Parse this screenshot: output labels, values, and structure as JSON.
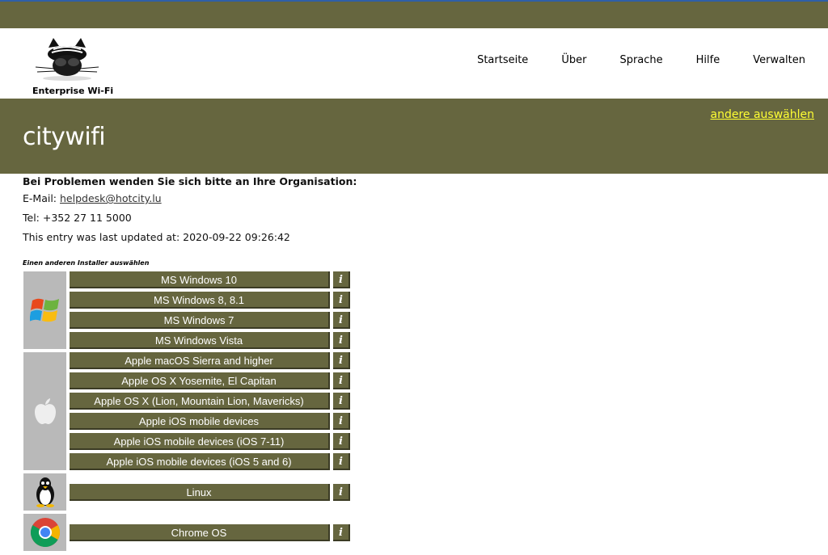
{
  "colors": {
    "band": "#66663f",
    "accent_link": "#ffff33",
    "os_cell": "#b9b9b9"
  },
  "header": {
    "logo_caption": "Enterprise Wi-Fi",
    "nav": [
      "Startseite",
      "Über",
      "Sprache",
      "Hilfe",
      "Verwalten"
    ]
  },
  "title_band": {
    "title": "citywifi",
    "other_link": "andere auswählen"
  },
  "info": {
    "problems_heading": "Bei Problemen wenden Sie sich bitte an Ihre Organisation:",
    "email_label": "E-Mail:",
    "email": "helpdesk@hotcity.lu",
    "tel": "Tel: +352 27 11 5000",
    "updated": "This entry was last updated at: 2020-09-22 09:26:42"
  },
  "installer_heading": "Einen anderen Installer auswählen",
  "info_symbol": "i",
  "groups": {
    "windows": {
      "icon": "windows-logo-icon",
      "items": [
        "MS Windows 10",
        "MS Windows 8, 8.1",
        "MS Windows 7",
        "MS Windows Vista"
      ]
    },
    "apple": {
      "icon": "apple-logo-icon",
      "items": [
        "Apple macOS Sierra and higher",
        "Apple OS X Yosemite, El Capitan",
        "Apple OS X (Lion, Mountain Lion, Mavericks)",
        "Apple iOS mobile devices",
        "Apple iOS mobile devices (iOS 7-11)",
        "Apple iOS mobile devices (iOS 5 and 6)"
      ]
    },
    "linux": {
      "icon": "tux-penguin-icon",
      "items": [
        "Linux"
      ]
    },
    "chrome": {
      "icon": "chrome-logo-icon",
      "items": [
        "Chrome OS"
      ]
    }
  }
}
